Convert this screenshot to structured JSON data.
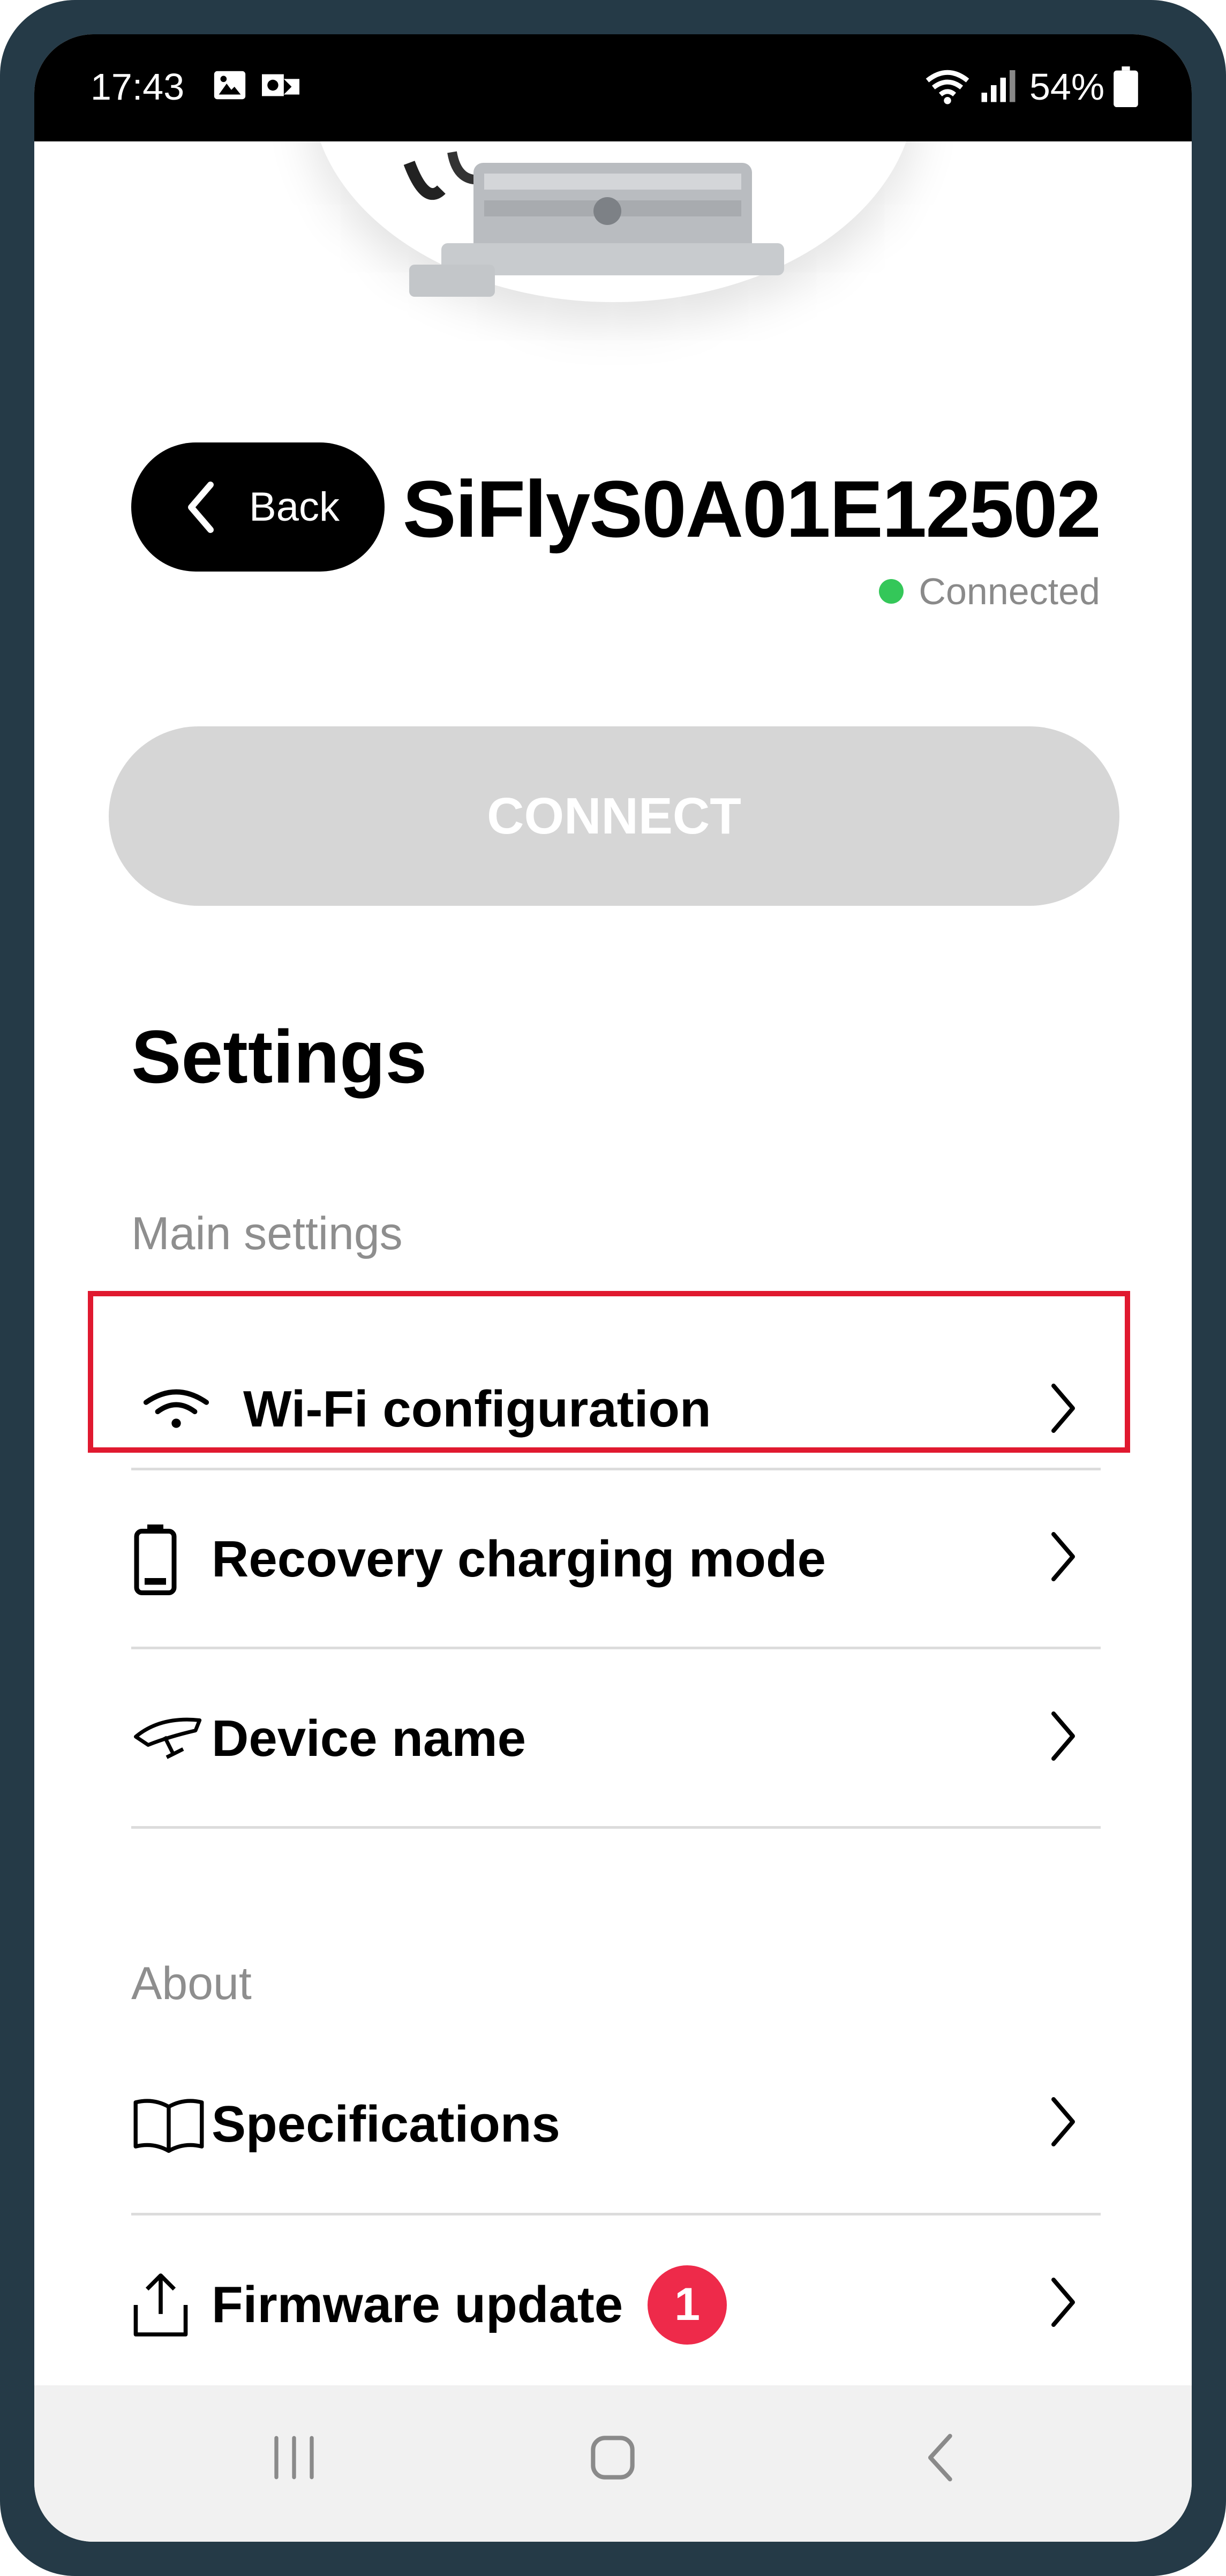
{
  "status_bar": {
    "time": "17:43",
    "battery_percent": "54%",
    "icons": [
      "gallery-icon",
      "outlook-icon",
      "wifi-icon",
      "signal-icon",
      "battery-icon"
    ]
  },
  "header": {
    "back_label": "Back",
    "device_name": "SiFlyS0A01E12502",
    "connection_status": "Connected",
    "status_color": "#34c759"
  },
  "connect_button": {
    "label": "CONNECT"
  },
  "settings": {
    "title": "Settings",
    "main_section_label": "Main settings",
    "main_items": [
      {
        "label": "Wi-Fi configuration",
        "icon": "wifi-icon"
      },
      {
        "label": "Recovery charging mode",
        "icon": "battery-icon"
      },
      {
        "label": "Device name",
        "icon": "drone-icon"
      }
    ],
    "about_section_label": "About",
    "about_items": [
      {
        "label": "Specifications",
        "icon": "book-icon"
      },
      {
        "label": "Firmware update",
        "icon": "upload-icon",
        "badge": "1"
      }
    ]
  },
  "highlight_color": "#e0192f",
  "nav_bar": {
    "items": [
      "recent-apps-icon",
      "home-icon",
      "back-icon"
    ]
  }
}
